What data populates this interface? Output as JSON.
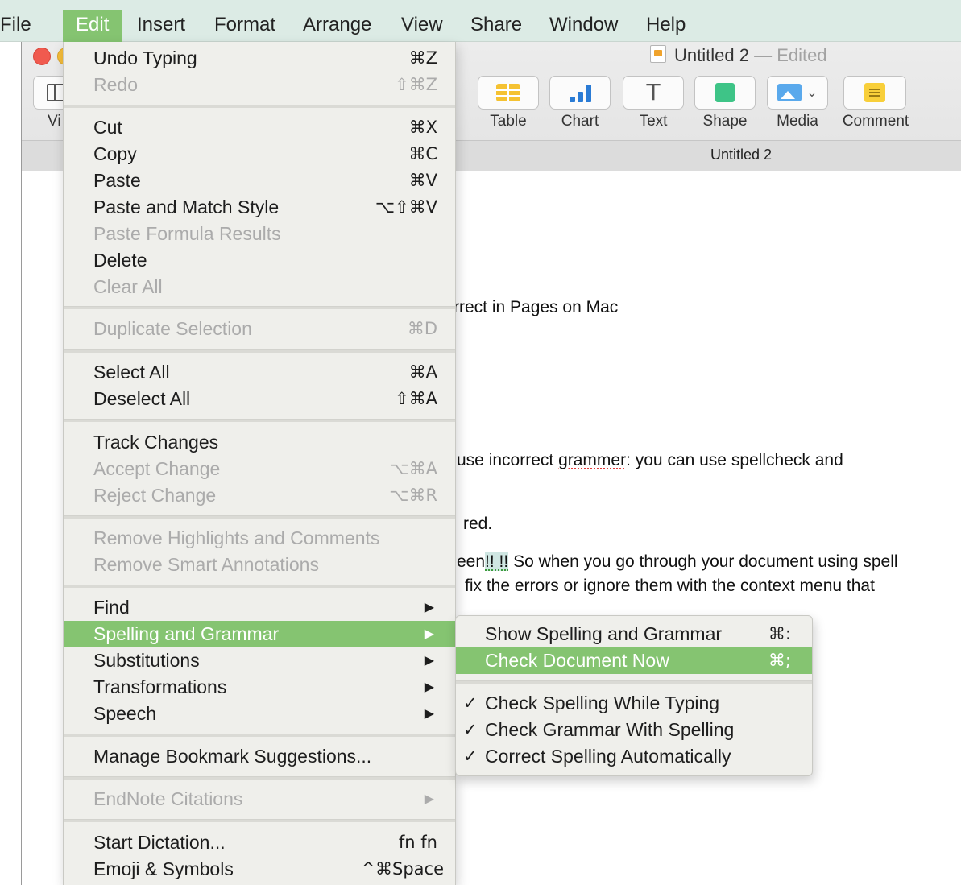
{
  "menubar": {
    "items": [
      "File",
      "Edit",
      "Insert",
      "Format",
      "Arrange",
      "View",
      "Share",
      "Window",
      "Help"
    ],
    "active": "Edit",
    "active_color": "#85c471"
  },
  "window": {
    "doc_title": "Untitled 2",
    "doc_status": "— Edited",
    "tab_title": "Untitled 2",
    "toolbar": {
      "view_label": "Vi",
      "table_label": "Table",
      "chart_label": "Chart",
      "text_label": "Text",
      "shape_label": "Shape",
      "media_label": "Media",
      "comment_label": "Comment"
    }
  },
  "document": {
    "line1": "rrect in Pages on Mac",
    "line2_before": "use incorrect ",
    "line2_error": "grammer",
    "line2_after": ": you can use spellcheck and",
    "line3": "red.",
    "line4_before": "een",
    "line4_hl": "!! !!",
    "line4_after": " So when you go through your document using spell",
    "line5": "fix the errors or ignore them with the context menu that"
  },
  "edit_menu": {
    "undo": {
      "label": "Undo Typing",
      "shortcut": "⌘Z"
    },
    "redo": {
      "label": "Redo",
      "shortcut": "⇧⌘Z"
    },
    "cut": {
      "label": "Cut",
      "shortcut": "⌘X"
    },
    "copy": {
      "label": "Copy",
      "shortcut": "⌘C"
    },
    "paste": {
      "label": "Paste",
      "shortcut": "⌘V"
    },
    "paste_match": {
      "label": "Paste and Match Style",
      "shortcut": "⌥⇧⌘V"
    },
    "paste_formula": {
      "label": "Paste Formula Results"
    },
    "delete": {
      "label": "Delete"
    },
    "clear_all": {
      "label": "Clear All"
    },
    "duplicate": {
      "label": "Duplicate Selection",
      "shortcut": "⌘D"
    },
    "select_all": {
      "label": "Select All",
      "shortcut": "⌘A"
    },
    "deselect_all": {
      "label": "Deselect All",
      "shortcut": "⇧⌘A"
    },
    "track_changes": {
      "label": "Track Changes"
    },
    "accept_change": {
      "label": "Accept Change",
      "shortcut": "⌥⌘A"
    },
    "reject_change": {
      "label": "Reject Change",
      "shortcut": "⌥⌘R"
    },
    "remove_highlights": {
      "label": "Remove Highlights and Comments"
    },
    "remove_smart": {
      "label": "Remove Smart Annotations"
    },
    "find": {
      "label": "Find"
    },
    "spelling": {
      "label": "Spelling and Grammar"
    },
    "substitutions": {
      "label": "Substitutions"
    },
    "transformations": {
      "label": "Transformations"
    },
    "speech": {
      "label": "Speech"
    },
    "bookmark": {
      "label": "Manage Bookmark Suggestions..."
    },
    "endnote": {
      "label": "EndNote Citations"
    },
    "dictation": {
      "label": "Start Dictation...",
      "shortcut": "fn fn"
    },
    "emoji": {
      "label": "Emoji & Symbols",
      "shortcut": "^⌘Space"
    }
  },
  "spelling_submenu": {
    "show": {
      "label": "Show Spelling and Grammar",
      "shortcut": "⌘:"
    },
    "check_now": {
      "label": "Check Document Now",
      "shortcut": "⌘;"
    },
    "check_typing": {
      "label": "Check Spelling While Typing",
      "checked": "✓"
    },
    "check_grammar": {
      "label": "Check Grammar With Spelling",
      "checked": "✓"
    },
    "correct_auto": {
      "label": "Correct Spelling Automatically",
      "checked": "✓"
    }
  }
}
